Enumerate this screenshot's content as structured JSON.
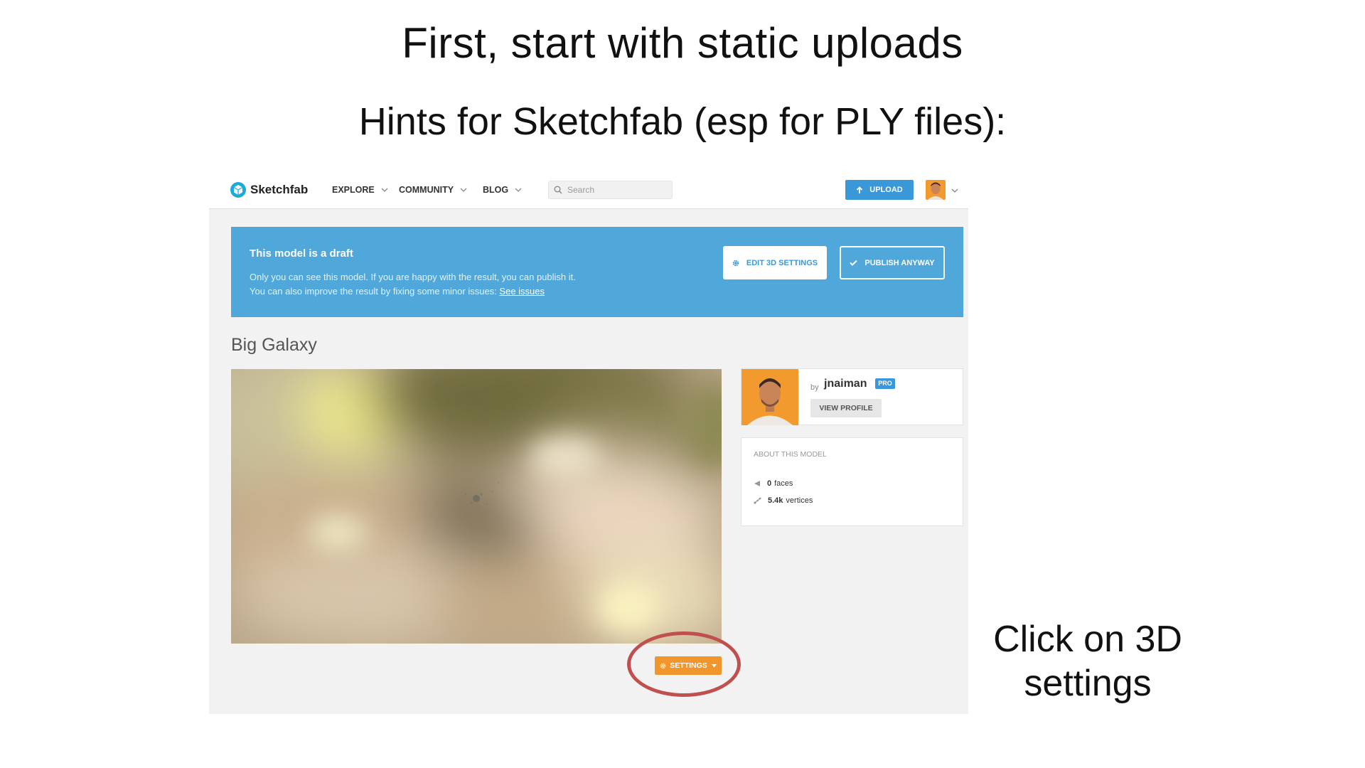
{
  "slide": {
    "title": "First, start with static uploads",
    "subtitle": "Hints for Sketchfab (esp for PLY files):",
    "note_line1": "Click on 3D",
    "note_line2": "settings"
  },
  "header": {
    "logo_text": "Sketchfab",
    "nav": [
      {
        "label": "EXPLORE"
      },
      {
        "label": "COMMUNITY"
      },
      {
        "label": "BLOG"
      }
    ],
    "search_placeholder": "Search",
    "upload_label": "UPLOAD"
  },
  "banner": {
    "title": "This model is a draft",
    "line1": "Only you can see this model. If you are happy with the result, you can publish it.",
    "line2_prefix": "You can also improve the result by fixing some minor issues:",
    "line2_link": "See issues",
    "edit_label": "EDIT 3D SETTINGS",
    "publish_label": "PUBLISH ANYWAY"
  },
  "model": {
    "title": "Big Galaxy",
    "settings_label": "SETTINGS"
  },
  "author": {
    "by": "by",
    "name": "jnaiman",
    "badge": "PRO",
    "view_profile": "VIEW PROFILE"
  },
  "about": {
    "label": "ABOUT THIS MODEL",
    "faces_value": "0",
    "faces_unit": "faces",
    "vertices_value": "5.4k",
    "vertices_unit": "vertices"
  },
  "colors": {
    "accent_blue": "#3a98d8",
    "banner_blue": "#50a7d9",
    "settings_orange": "#f0962c",
    "highlight_red": "#c0504d"
  }
}
